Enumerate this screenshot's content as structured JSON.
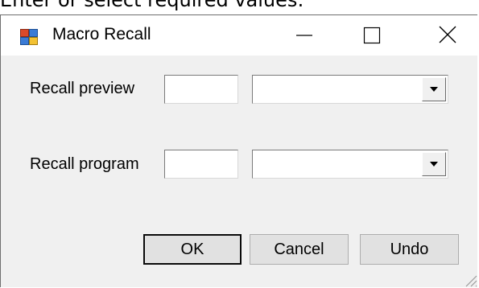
{
  "instruction_text": "Enter or select required values:",
  "window": {
    "title": "Macro Recall",
    "icon": "application-window-icon",
    "minimize_glyph": "minimize-icon",
    "maximize_glyph": "maximize-icon",
    "close_glyph": "close-icon"
  },
  "fields": {
    "preview": {
      "label": "Recall preview",
      "number_value": "",
      "combo_value": ""
    },
    "program": {
      "label": "Recall program",
      "number_value": "",
      "combo_value": ""
    }
  },
  "buttons": {
    "ok": "OK",
    "cancel": "Cancel",
    "undo": "Undo"
  },
  "colors": {
    "dialog_background": "#f0f0f0",
    "titlebar_background": "#ffffff",
    "button_face": "#e1e1e1"
  }
}
